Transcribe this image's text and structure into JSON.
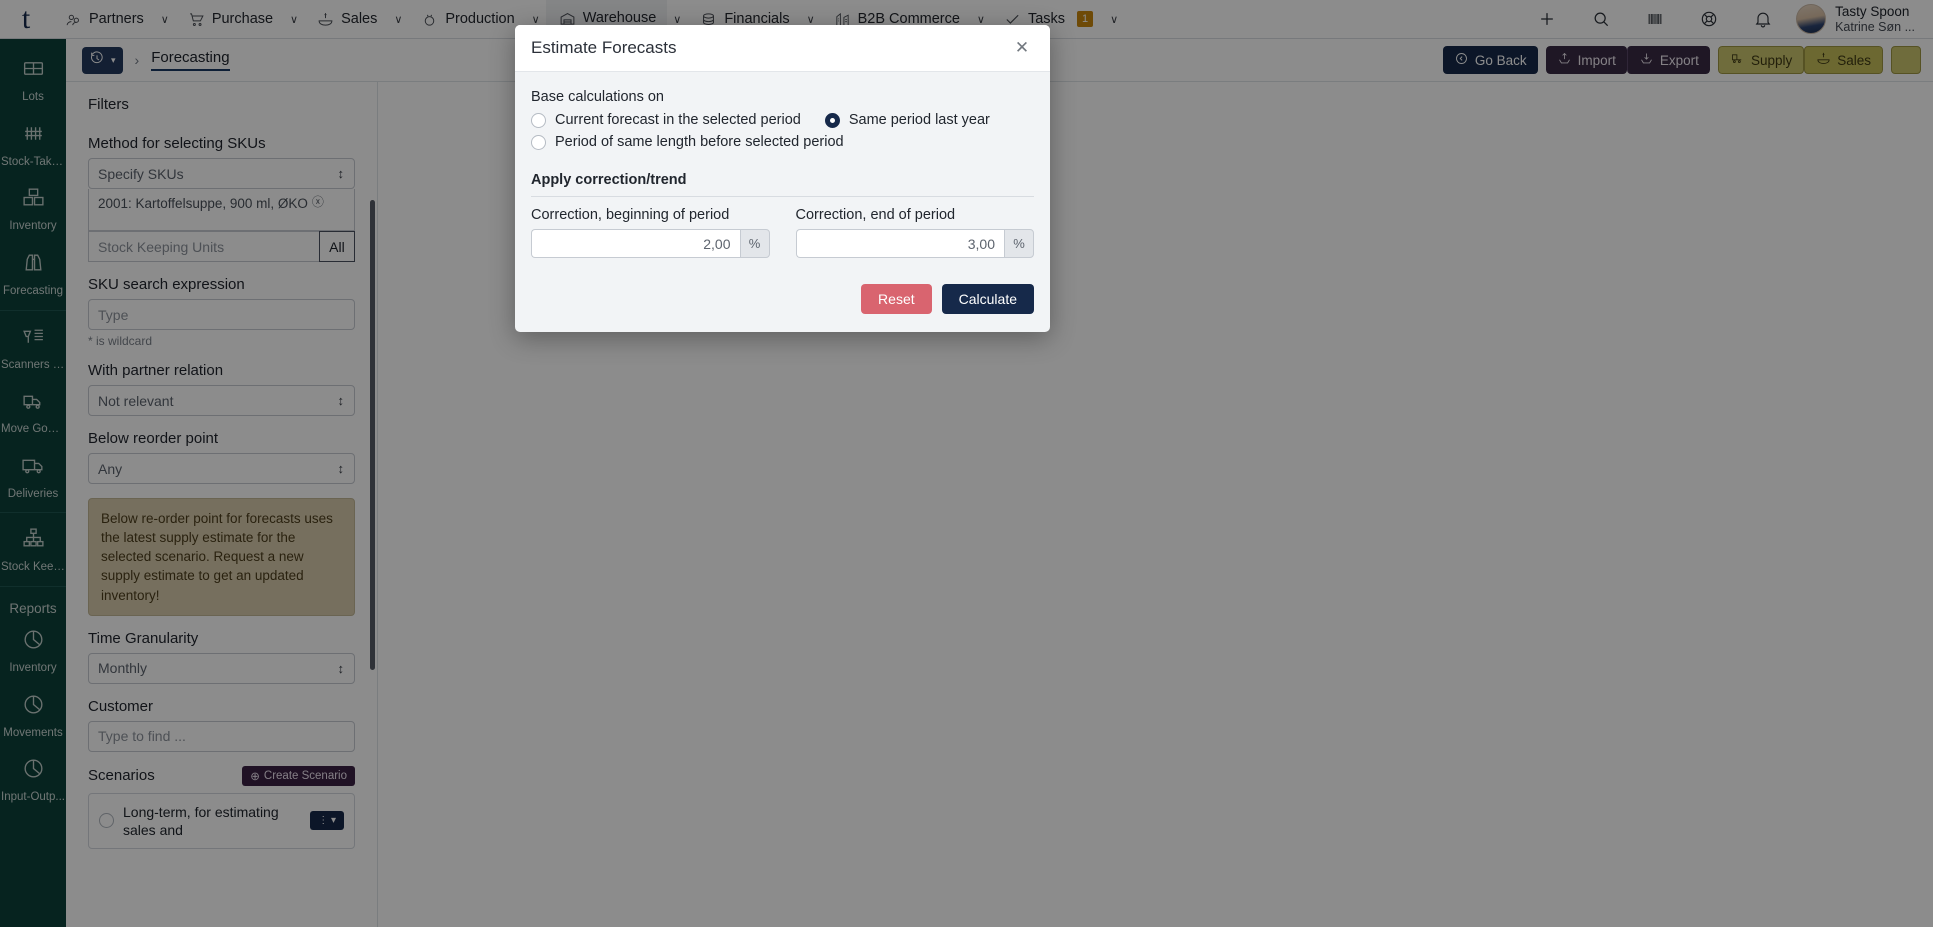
{
  "topnav": {
    "brand": "t",
    "items": [
      {
        "label": "Partners",
        "icon": "partners-icon",
        "caret": "∨",
        "active": false
      },
      {
        "label": "Purchase",
        "icon": "cart-icon",
        "caret": "∨",
        "active": false
      },
      {
        "label": "Sales",
        "icon": "sales-icon",
        "caret": "∨",
        "active": false
      },
      {
        "label": "Production",
        "icon": "production-icon",
        "caret": "∨",
        "active": false
      },
      {
        "label": "Warehouse",
        "icon": "warehouse-icon",
        "caret": "∨",
        "active": true
      },
      {
        "label": "Financials",
        "icon": "coins-icon",
        "caret": "∨",
        "active": false
      },
      {
        "label": "B2B Commerce",
        "icon": "b2b-icon",
        "caret": "∨",
        "active": false
      },
      {
        "label": "Tasks",
        "icon": "check-icon",
        "caret": "∨",
        "active": false,
        "badge": "1"
      }
    ],
    "right_icons": [
      "plus-icon",
      "search-icon",
      "barcode-icon",
      "lifebuoy-icon",
      "bell-icon"
    ],
    "user": {
      "company": "Tasty Spoon",
      "name": "Katrine Søn ..."
    }
  },
  "rail": {
    "items": [
      {
        "label": "Lots",
        "icon": "box-icon"
      },
      {
        "label": "Stock-Taking",
        "icon": "tally-icon"
      },
      {
        "label": "Inventory",
        "icon": "boxes-icon"
      },
      {
        "label": "Forecasting",
        "icon": "binoculars-icon"
      },
      {
        "label": "Scanners &...",
        "icon": "scanner-icon",
        "sep_before": true
      },
      {
        "label": "Move Goods",
        "icon": "move-truck-icon"
      },
      {
        "label": "Deliveries",
        "icon": "delivery-truck-icon"
      },
      {
        "label": "Stock Keep...",
        "icon": "hierarchy-icon",
        "sep_before": true
      }
    ],
    "reports_heading": "Reports",
    "reports": [
      {
        "label": "Inventory",
        "icon": "pie-chart-icon"
      },
      {
        "label": "Movements",
        "icon": "pie-chart-icon"
      },
      {
        "label": "Input-Outp...",
        "icon": "pie-chart-icon"
      }
    ]
  },
  "breadcrumb": {
    "history_icon": "history-icon",
    "history_caret": "▾",
    "separator": "›",
    "current": "Forecasting"
  },
  "toolbar": {
    "go_back": "Go Back",
    "go_back_icon": "back-arrow-icon",
    "import": "Import",
    "import_icon": "import-icon",
    "export": "Export",
    "export_icon": "export-icon",
    "supply": "Supply",
    "supply_icon": "forklift-icon",
    "sales": "Sales",
    "sales_icon": "sales-icon",
    "help_icon": "question-icon"
  },
  "filters": {
    "title": "Filters",
    "method_label": "Method for selecting SKUs",
    "method_value": "Specify SKUs",
    "selected_sku": "2001: Kartoffelsuppe, 900 ml, ØKO",
    "sku_remove_icon": "remove-circle-icon",
    "sku_placeholder": "Stock Keeping Units",
    "sku_all": "All",
    "search_label": "SKU search expression",
    "search_placeholder": "Type",
    "wildcard_hint": "* is wildcard",
    "partner_label": "With partner relation",
    "partner_value": "Not relevant",
    "reorder_label": "Below reorder point",
    "reorder_value": "Any",
    "info_text": "Below re-order point for forecasts uses the latest supply estimate for the selected scenario. Request a new supply estimate to get an updated inventory!",
    "granularity_label": "Time Granularity",
    "granularity_value": "Monthly",
    "customer_label": "Customer",
    "customer_placeholder": "Type to find ...",
    "scenarios_label": "Scenarios",
    "create_scenario": "Create Scenario",
    "create_scenario_icon": "plus-circle-icon",
    "scenario_name": "Long-term, for estimating sales and",
    "scenario_menu_icon": "kebab-menu-icon"
  },
  "modal": {
    "title": "Estimate Forecasts",
    "close_icon": "close-icon",
    "base_label": "Base calculations on",
    "options": [
      {
        "label": "Current forecast in the selected period",
        "selected": false
      },
      {
        "label": "Same period last year",
        "selected": true
      },
      {
        "label": "Period of same length before selected period",
        "selected": false
      }
    ],
    "correction_title": "Apply correction/trend",
    "begin_label": "Correction, beginning of period",
    "begin_value": "2,00",
    "begin_unit": "%",
    "end_label": "Correction, end of period",
    "end_value": "3,00",
    "end_unit": "%",
    "reset": "Reset",
    "calculate": "Calculate"
  },
  "colors": {
    "navy": "#16294a",
    "rail_green": "#0b4039",
    "reset_red": "#d9646f",
    "badge_gold": "#c8870d",
    "olive": "#cbc56d",
    "info_tan": "#d7cbab"
  }
}
